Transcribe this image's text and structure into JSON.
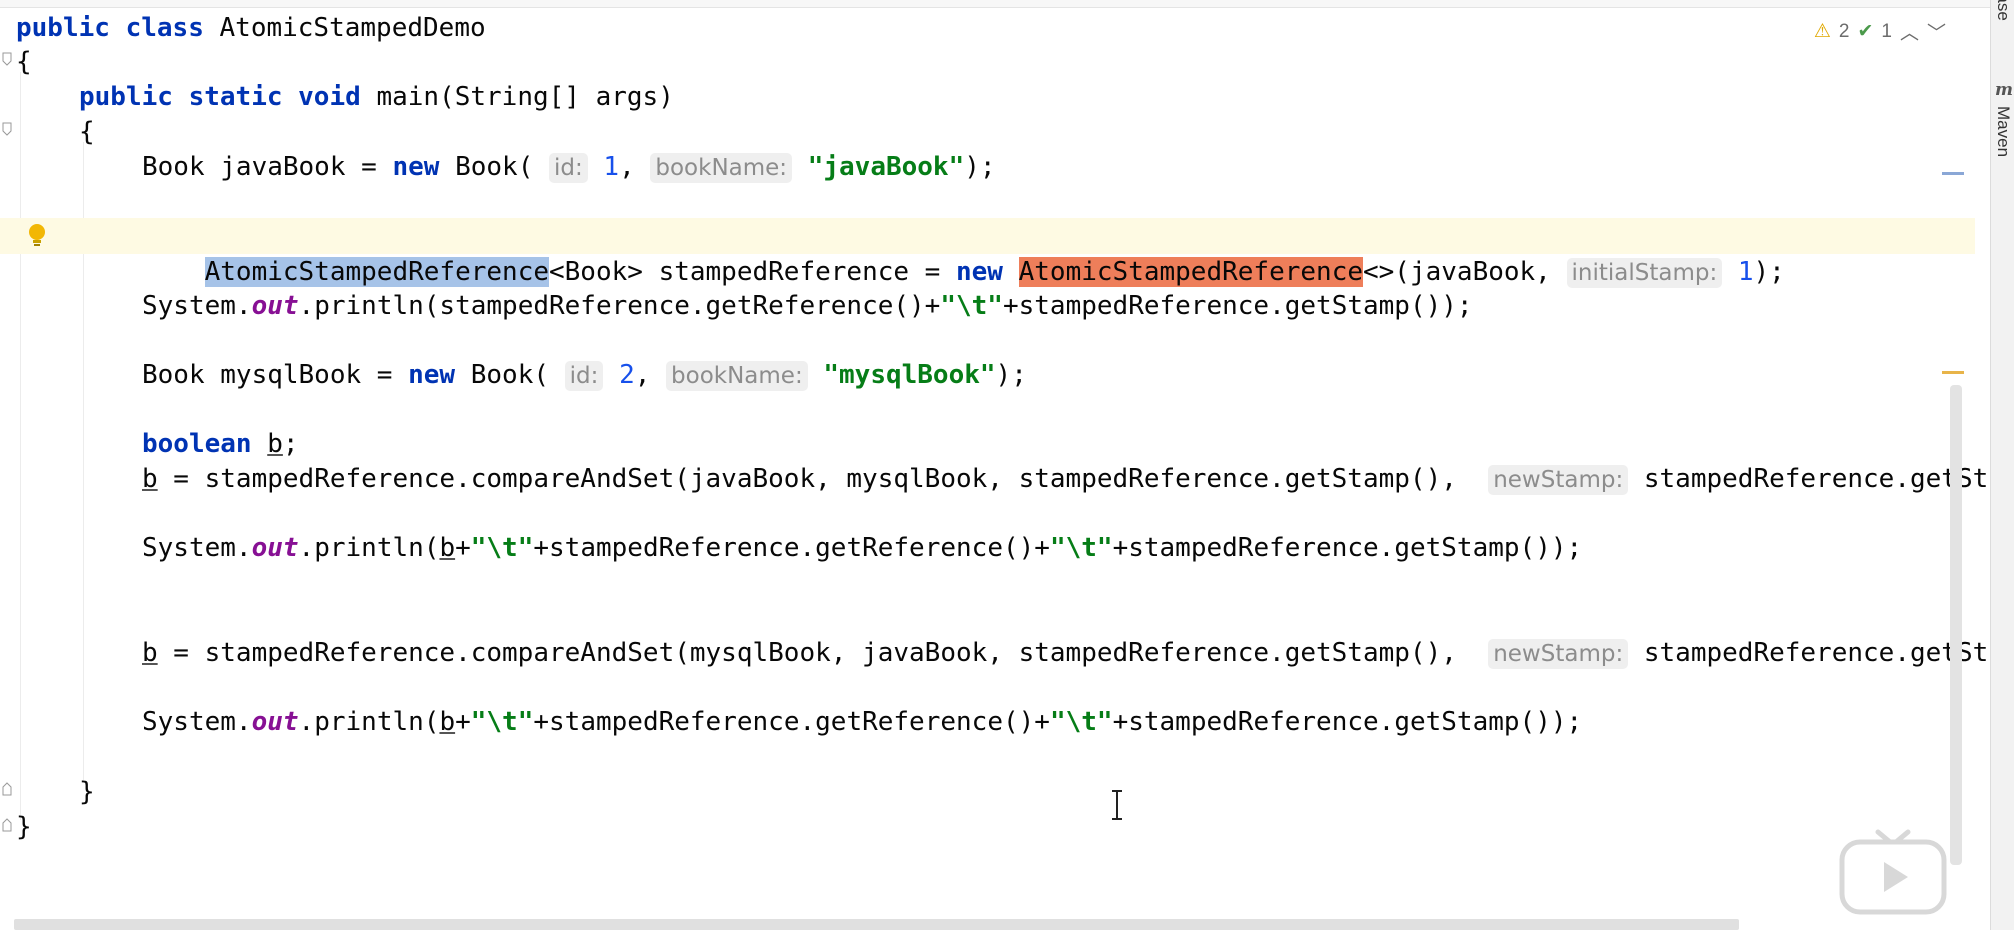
{
  "status": {
    "warnings": "2",
    "checks": "1"
  },
  "side_panel": {
    "database_label": "Database",
    "maven_label": "Maven",
    "maven_icon": "m"
  },
  "code": {
    "l1": {
      "kw1": "public",
      "kw2": "class",
      "name": "AtomicStampedDemo"
    },
    "l2": {
      "brace": "{"
    },
    "l3": {
      "kw1": "public",
      "kw2": "static",
      "kw3": "void",
      "rest": "main(String[] args)"
    },
    "l4": {
      "brace": "{"
    },
    "l5": {
      "pre": "Book javaBook = ",
      "kw": "new",
      "mid": " Book(",
      "hint1": "id:",
      "val1": "1",
      "comma": ",",
      "hint2": "bookName:",
      "str": "\"javaBook\"",
      "end": ");"
    },
    "l6": {
      "sel": "AtomicStampedReference",
      "mid": "<Book> stampedReference = ",
      "kw": "new",
      "hl": "AtomicStampedReference",
      "post": "<>(javaBook,",
      "hint": "initialStamp:",
      "val": "1",
      "end": ");"
    },
    "l7": {
      "pre": "System.",
      "fld": "out",
      "mid1": ".println(stampedReference.getReference()+",
      "str": "\"\\t\"",
      "mid2": "+stampedReference.getStamp());"
    },
    "l8": {
      "pre": "Book mysqlBook = ",
      "kw": "new",
      "mid": " Book(",
      "hint1": "id:",
      "val1": "2",
      "comma": ",",
      "hint2": "bookName:",
      "str": "\"mysqlBook\"",
      "end": ");"
    },
    "l9": {
      "kw": "boolean",
      "var": "b",
      "end": ";"
    },
    "l10": {
      "var": "b",
      "mid": " = stampedReference.compareAndSet(javaBook, mysqlBook, stampedReference.getStamp(),",
      "hint": "newStamp:",
      "tail": "stampedReference.getSt"
    },
    "l11": {
      "pre": "System.",
      "fld": "out",
      "mid0": ".println(",
      "var": "b",
      "plus": "+",
      "str1": "\"\\t\"",
      "mid1": "+stampedReference.getReference()+",
      "str2": "\"\\t\"",
      "mid2": "+stampedReference.getStamp());"
    },
    "l12": {
      "var": "b",
      "mid": " = stampedReference.compareAndSet(mysqlBook, javaBook, stampedReference.getStamp(),",
      "hint": "newStamp:",
      "tail": "stampedReference.getSt"
    },
    "l13": {
      "pre": "System.",
      "fld": "out",
      "mid0": ".println(",
      "var": "b",
      "plus": "+",
      "str1": "\"\\t\"",
      "mid1": "+stampedReference.getReference()+",
      "str2": "\"\\t\"",
      "mid2": "+stampedReference.getStamp());"
    },
    "l14": {
      "brace": "}"
    },
    "l15": {
      "brace": "}"
    }
  },
  "colors": {
    "keyword": "#0033b3",
    "string": "#067d17",
    "static_field": "#871094",
    "number": "#1750eb",
    "selection": "#a6c3e8",
    "highlight": "#ee7e5a",
    "caret_row": "#fefae3"
  }
}
